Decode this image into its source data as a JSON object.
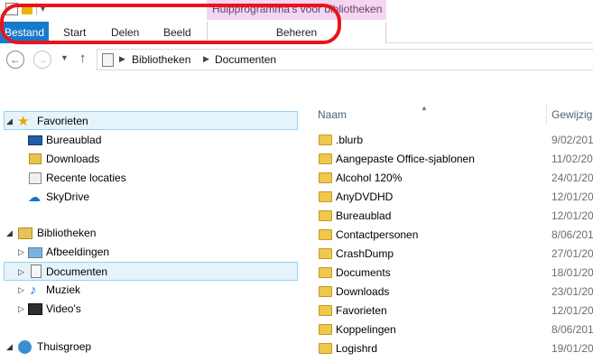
{
  "contextual_tab": {
    "title": "Hulpprogramma's voor bibliotheken"
  },
  "ribbon": {
    "file_tab": "Bestand",
    "tabs": [
      "Start",
      "Delen",
      "Beeld"
    ],
    "manage_tab": "Beheren"
  },
  "address": {
    "crumbs": [
      "Bibliotheken",
      "Documenten"
    ]
  },
  "nav": {
    "favorites": {
      "label": "Favorieten",
      "items": [
        "Bureaublad",
        "Downloads",
        "Recente locaties",
        "SkyDrive"
      ]
    },
    "libraries": {
      "label": "Bibliotheken",
      "items": [
        "Afbeeldingen",
        "Documenten",
        "Muziek",
        "Video's"
      ]
    },
    "homegroup": {
      "label": "Thuisgroep"
    }
  },
  "files": {
    "col_name": "Naam",
    "col_date": "Gewijzig",
    "rows": [
      {
        "name": ".blurb",
        "date": "9/02/201"
      },
      {
        "name": "Aangepaste Office-sjablonen",
        "date": "11/02/20"
      },
      {
        "name": "Alcohol 120%",
        "date": "24/01/20"
      },
      {
        "name": "AnyDVDHD",
        "date": "12/01/20"
      },
      {
        "name": "Bureaublad",
        "date": "12/01/20"
      },
      {
        "name": "Contactpersonen",
        "date": "8/06/201"
      },
      {
        "name": "CrashDump",
        "date": "27/01/20"
      },
      {
        "name": "Documents",
        "date": "18/01/20"
      },
      {
        "name": "Downloads",
        "date": "23/01/20"
      },
      {
        "name": "Favorieten",
        "date": "12/01/20"
      },
      {
        "name": "Koppelingen",
        "date": "8/06/201"
      },
      {
        "name": "Logishrd",
        "date": "19/01/20"
      }
    ]
  },
  "colors": {
    "file_tab_bg": "#1979ca",
    "annotation": "#e8141c",
    "contextual_bg": "#f3d7f0",
    "selection": "#e5f3fb"
  }
}
